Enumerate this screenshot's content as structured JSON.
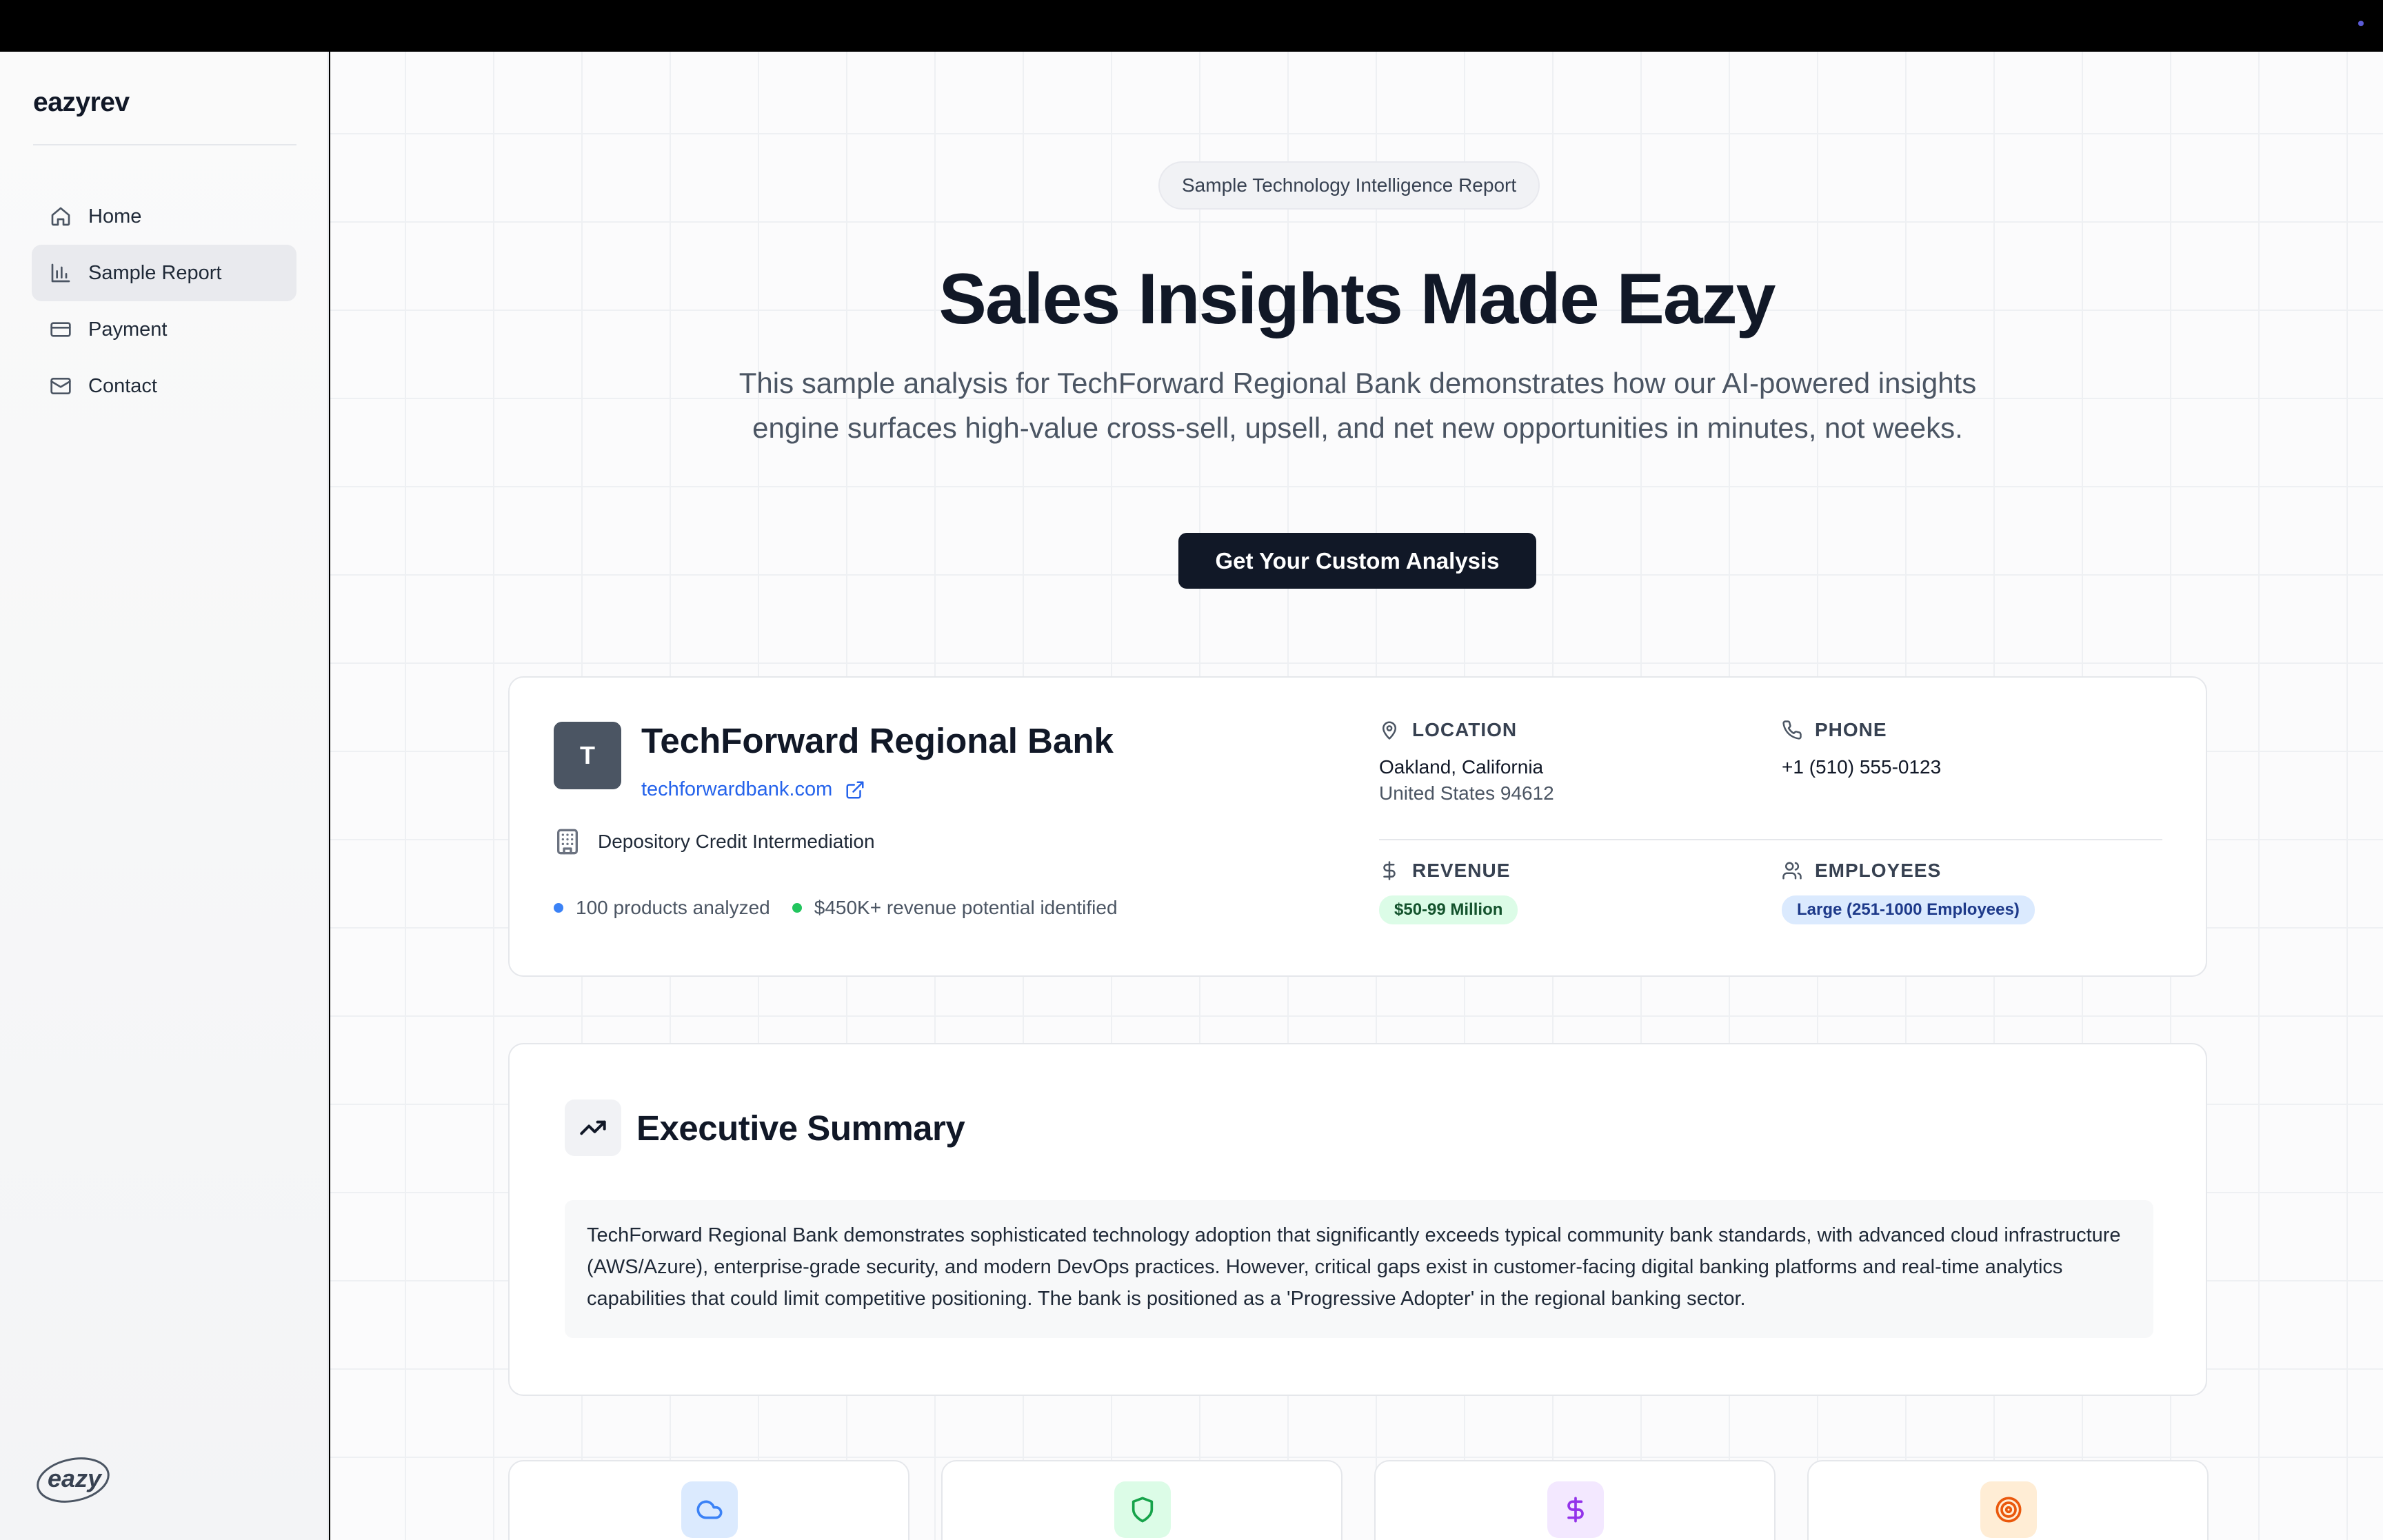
{
  "app": {
    "brand": "eazyrev"
  },
  "sidebar": {
    "items": [
      {
        "label": "Home",
        "icon": "home-icon"
      },
      {
        "label": "Sample Report",
        "icon": "bar-chart-icon",
        "active": true
      },
      {
        "label": "Payment",
        "icon": "credit-card-icon"
      },
      {
        "label": "Contact",
        "icon": "mail-icon"
      }
    ],
    "footer_logo": "eazy"
  },
  "hero": {
    "pill": "Sample Technology Intelligence Report",
    "title": "Sales Insights Made Eazy",
    "description": "This sample analysis for TechForward Regional Bank demonstrates how our AI-powered insights engine surfaces high-value cross-sell, upsell, and net new opportunities in minutes, not weeks.",
    "cta": "Get Your Custom Analysis"
  },
  "company": {
    "initial": "T",
    "name": "TechForward Regional Bank",
    "website": "techforwardbank.com",
    "industry": "Depository Credit Intermediation",
    "stats": [
      {
        "text": "100 products analyzed",
        "color": "#3b82f6"
      },
      {
        "text": "$450K+ revenue potential identified",
        "color": "#22c55e"
      }
    ],
    "location": {
      "label": "LOCATION",
      "line1": "Oakland, California",
      "line2": "United States 94612"
    },
    "phone": {
      "label": "PHONE",
      "value": "+1 (510) 555-0123"
    },
    "revenue": {
      "label": "REVENUE",
      "value": "$50-99 Million"
    },
    "employees": {
      "label": "EMPLOYEES",
      "value": "Large (251-1000 Employees)"
    }
  },
  "executive_summary": {
    "title": "Executive Summary",
    "body": "TechForward Regional Bank demonstrates sophisticated technology adoption that significantly exceeds typical community bank standards, with advanced cloud infrastructure (AWS/Azure), enterprise-grade security, and modern DevOps practices. However, critical gaps exist in customer-facing digital banking platforms and real-time analytics capabilities that could limit competitive positioning. The bank is positioned as a 'Progressive Adopter' in the regional banking sector."
  },
  "feature_cards": [
    {
      "icon": "cloud-icon",
      "bg": "#dbeafe",
      "color": "#3b82f6"
    },
    {
      "icon": "shield-icon",
      "bg": "#dcfce7",
      "color": "#16a34a"
    },
    {
      "icon": "dollar-icon",
      "bg": "#f3e8ff",
      "color": "#9333ea"
    },
    {
      "icon": "target-icon",
      "bg": "#ffedd5",
      "color": "#ea580c"
    }
  ]
}
